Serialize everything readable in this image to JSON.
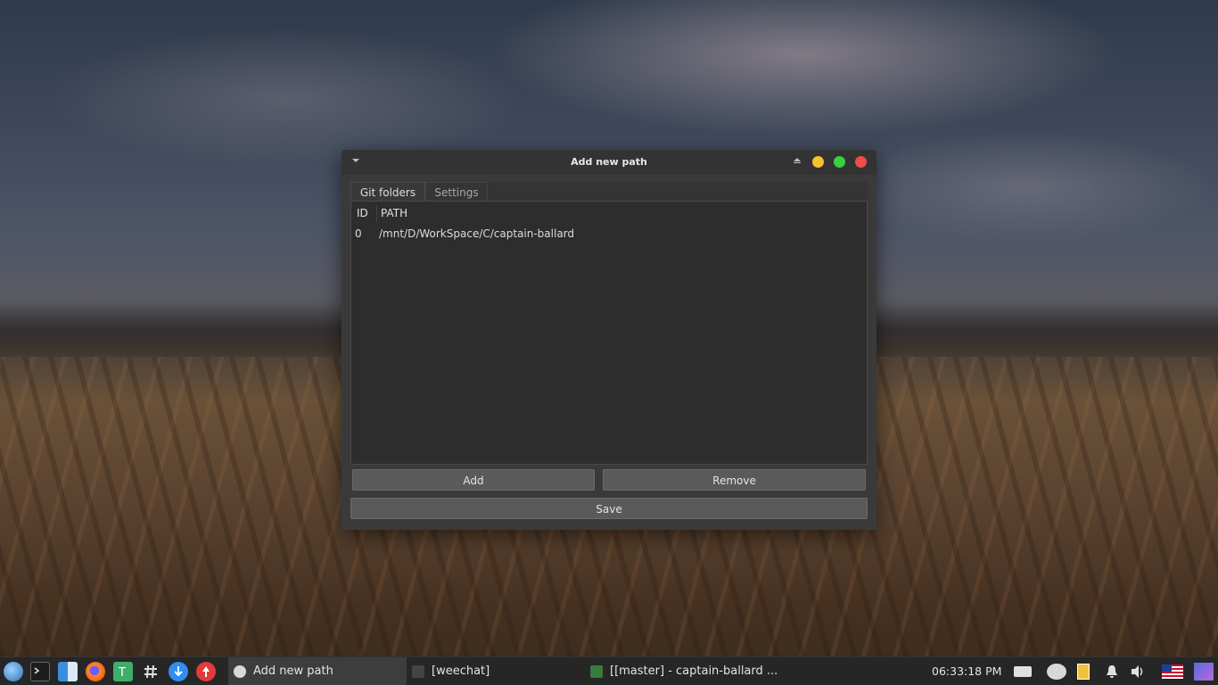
{
  "window": {
    "title": "Add new path",
    "tabs": [
      {
        "label": "Git folders",
        "active": true
      },
      {
        "label": "Settings",
        "active": false
      }
    ],
    "table": {
      "columns": [
        "ID",
        "PATH"
      ],
      "rows": [
        {
          "id": "0",
          "path": "/mnt/D/WorkSpace/C/captain-ballard"
        }
      ]
    },
    "buttons": {
      "add": "Add",
      "remove": "Remove",
      "save": "Save"
    }
  },
  "taskbar": {
    "launchers": [
      "app-menu-icon",
      "terminal-icon",
      "file-manager-icon",
      "firefox-icon",
      "text-editor-icon",
      "slack-icon",
      "download-manager-icon",
      "update-icon"
    ],
    "tasks": [
      {
        "label": "Add new path",
        "active": true
      },
      {
        "label": "[weechat]",
        "active": false
      },
      {
        "label": "[[master] - captain-ballard ...",
        "active": false
      }
    ],
    "clock": "06:33:18 PM",
    "tray": [
      "battery-icon",
      "network-icon",
      "clipboard-icon",
      "notification-bell-icon",
      "volume-icon",
      "us-flag-icon",
      "desktop-icon"
    ]
  },
  "colors": {
    "window_bg": "#3a3a3a",
    "titlebar_bg": "#333333",
    "minimize": "#f7c02c",
    "maximize": "#37d03e",
    "close": "#f34a4a"
  }
}
